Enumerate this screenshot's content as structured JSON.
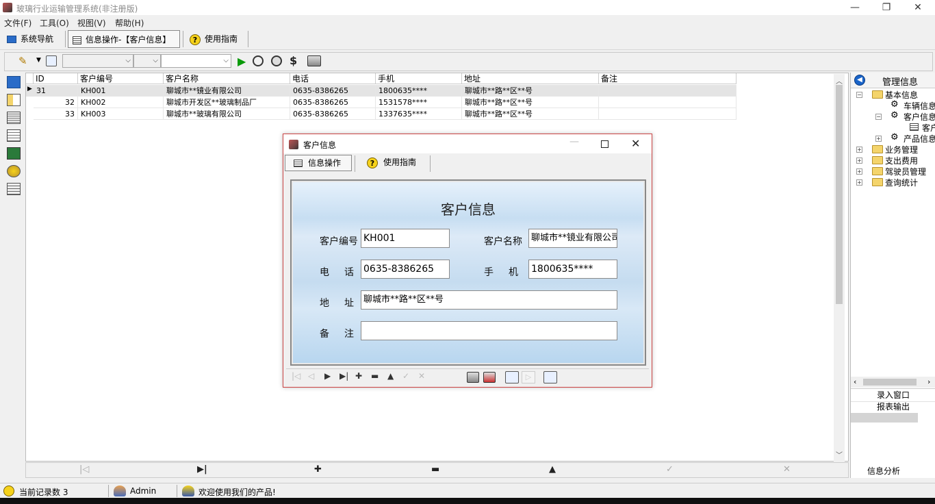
{
  "window": {
    "title": "玻璃行业运输管理系统(非注册版)",
    "controls": [
      "—",
      "❐",
      "✕"
    ]
  },
  "menu": [
    "文件(F)",
    "工具(O)",
    "视图(V)",
    "帮助(H)"
  ],
  "toolbar": {
    "nav_label": "系统导航",
    "info_label": "信息操作-【客户信息】",
    "guide_label": "使用指南"
  },
  "grid": {
    "columns": [
      "ID",
      "客户编号",
      "客户名称",
      "电话",
      "手机",
      "地址",
      "备注"
    ],
    "rows": [
      {
        "id": "31",
        "code": "KH001",
        "name": "聊城市**镜业有限公司",
        "phone": "0635-8386265",
        "mobile": "1800635****",
        "address": "聊城市**路**区**号",
        "note": ""
      },
      {
        "id": "32",
        "code": "KH002",
        "name": "聊城市开发区**玻璃制品厂",
        "phone": "0635-8386265",
        "mobile": "1531578****",
        "address": "聊城市**路**区**号",
        "note": ""
      },
      {
        "id": "33",
        "code": "KH003",
        "name": "聊城市**玻璃有限公司",
        "phone": "0635-8386265",
        "mobile": "1337635****",
        "address": "聊城市**路**区**号",
        "note": ""
      }
    ],
    "nav_symbols": [
      "|◁",
      "▶|",
      "✚",
      "▬",
      "▲",
      "✓",
      "✕"
    ]
  },
  "right_panel": {
    "header": "管理信息",
    "tree": [
      {
        "label": "基本信息",
        "kind": "folder",
        "expanded": true
      },
      {
        "label": "车辆信息",
        "kind": "item"
      },
      {
        "label": "客户信息",
        "kind": "item"
      },
      {
        "label": "客户",
        "kind": "leaf"
      },
      {
        "label": "产品信息",
        "kind": "item"
      },
      {
        "label": "业务管理",
        "kind": "folder"
      },
      {
        "label": "支出费用",
        "kind": "folder"
      },
      {
        "label": "驾驶员管理",
        "kind": "folder"
      },
      {
        "label": "查询统计",
        "kind": "folder"
      }
    ],
    "buttons": [
      "录入窗口",
      "报表输出"
    ],
    "footer": "信息分析"
  },
  "status": {
    "record_count": "当前记录数 3",
    "user": "Admin",
    "welcome": "欢迎使用我们的产品!"
  },
  "dialog": {
    "title": "客户信息",
    "tab_info": "信息操作",
    "tab_guide": "使用指南",
    "form_title": "客户信息",
    "labels": {
      "code": "客户编号",
      "name": "客户名称",
      "phone": "电　话",
      "mobile": "手　机",
      "address": "地　址",
      "note": "备　注"
    },
    "values": {
      "code": "KH001",
      "name": "聊城市**镜业有限公司",
      "phone": "0635-8386265",
      "mobile": "1800635****",
      "address": "聊城市**路**区**号",
      "note": ""
    }
  }
}
